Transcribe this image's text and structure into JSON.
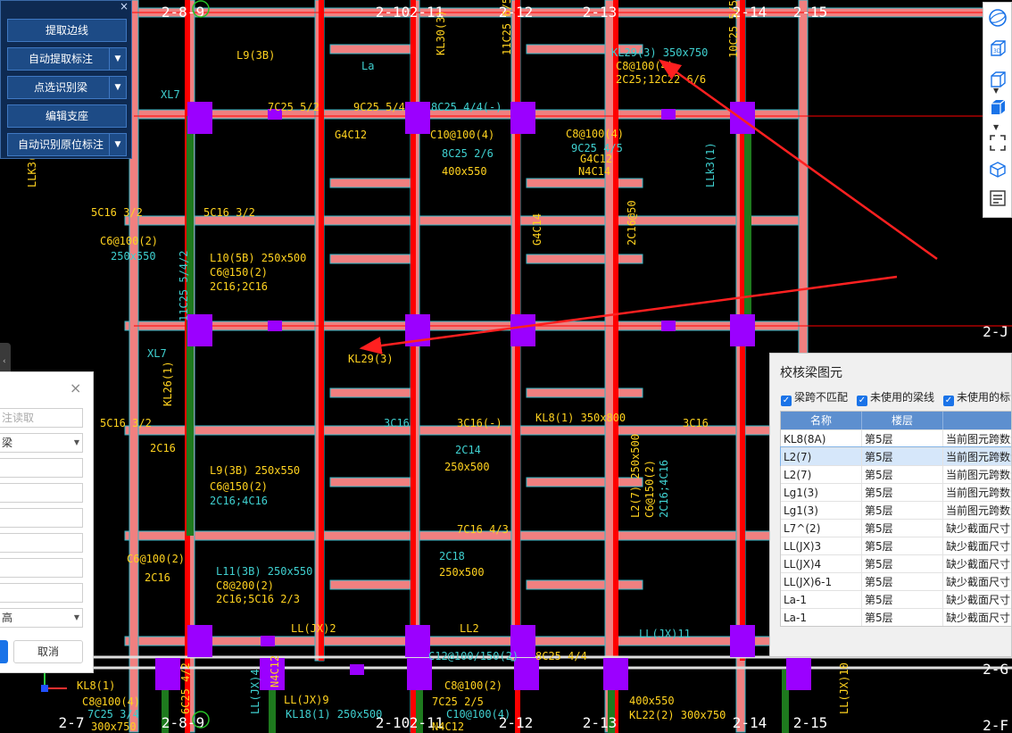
{
  "tool_panel": {
    "close": "×",
    "buttons": [
      {
        "label": "提取边线",
        "dropdown": false
      },
      {
        "label": "自动提取标注",
        "dropdown": true
      },
      {
        "label": "点选识别梁",
        "dropdown": true
      },
      {
        "label": "编辑支座",
        "dropdown": false
      },
      {
        "label": "自动识别原位标注",
        "dropdown": true
      }
    ],
    "dropdown_arrow": "▼"
  },
  "axes": {
    "top": [
      "2-8-9",
      "2-10",
      "2-11",
      "2-12",
      "2-13",
      "2-14",
      "2-15"
    ],
    "bottom": [
      "2-7",
      "2-8-9",
      "2-10",
      "2-11",
      "2-12",
      "2-13",
      "2-14",
      "2-15"
    ],
    "right": [
      "2-J",
      "2-G",
      "2-F"
    ]
  },
  "cad_labels": {
    "yellow": [
      "L9(3B)",
      "La",
      "KL30(3)",
      "11C25 6/5",
      "KL29(3) 350x750",
      "C8@100(4)",
      "2C25;12C22 6/6",
      "10C25 5/5",
      "XL7",
      "7C25 5/2",
      "9C25 5/4",
      "8C25 4/4(-)",
      "5C16 3/2",
      "G4C12",
      "C10@100(4)",
      "8C25 2/6",
      "400x550",
      "C8@100(4)",
      "9C25 4/5",
      "G4C12",
      "N4C14",
      "LLK3(1)",
      "LLk3(1)",
      "5C16 3/2",
      "C6@100(2)",
      "250x550",
      "L10(5B) 250x500",
      "C6@150(2)",
      "2C16;2C16",
      "11C25 5/4/2",
      "G4C14",
      "2C16@50",
      "XL7",
      "KL29(3)",
      "KL26(1)",
      "5C16 3/2",
      "3C16",
      "3C16(-)",
      "2C16",
      "2C14",
      "250x500",
      "L9(3B) 250x550",
      "C6@150(2)",
      "2C16;4C16",
      "L2(7) 250x500",
      "C6@150(2)",
      "2C16;4C16",
      "7C16 4/3",
      "C6@100(2)",
      "2C16",
      "L11(3B) 250x550",
      "C8@200(2)",
      "2C16;5C16 2/3",
      "2C18",
      "250x500",
      "LL(JX)2",
      "LL2",
      "LL(JX)11",
      "KL8(1)",
      "C8@100(4)",
      "7C25 3/4",
      "300x750",
      "N4C12",
      "LL(JX)9",
      "KL18(1) 250x500",
      "C8@100(2)",
      "7C25 2/5",
      "C10@100(4)",
      "N4C12",
      "400x550",
      "KL22(2) 300x750",
      "C12@100/150(2)",
      "8C25 4/4",
      "6C25 4/2",
      "LL(JX)4",
      "LL(JX)10",
      "KL8(1) 350x800",
      "3C16",
      "5C16 3/2"
    ]
  },
  "right_toolbar": {
    "icons": [
      "sphere-icon",
      "cube-3d-icon",
      "cube-outline-icon",
      "cube-solid-icon",
      "fit-view-icon",
      "box-icon",
      "list-view-icon"
    ],
    "label_3d": "3D"
  },
  "left_dialog": {
    "close": "×",
    "fields": [
      {
        "value": "注读取",
        "placeholder": true,
        "dropdown": false
      },
      {
        "value": "梁",
        "placeholder": false,
        "dropdown": true
      },
      {
        "value": "",
        "placeholder": false,
        "dropdown": false
      },
      {
        "value": "",
        "placeholder": false,
        "dropdown": false
      },
      {
        "value": "",
        "placeholder": false,
        "dropdown": false
      },
      {
        "value": "",
        "placeholder": false,
        "dropdown": false
      },
      {
        "value": "",
        "placeholder": false,
        "dropdown": false
      },
      {
        "value": "",
        "placeholder": false,
        "dropdown": false
      },
      {
        "value": "高",
        "placeholder": false,
        "dropdown": true
      }
    ],
    "cancel_label": "取消"
  },
  "check_dialog": {
    "title": "校核梁图元",
    "checkboxes": [
      {
        "label": "梁跨不匹配",
        "checked": true
      },
      {
        "label": "未使用的梁线",
        "checked": true
      },
      {
        "label": "未使用的标注",
        "checked": true
      }
    ],
    "columns": [
      "名称",
      "楼层",
      ""
    ],
    "rows": [
      {
        "name": "KL8(8A)",
        "floor": "第5层",
        "desc": "当前图元跨数大于原位标注跨数"
      },
      {
        "name": "L2(7)",
        "floor": "第5层",
        "desc": "当前图元跨数大于原位标注跨数"
      },
      {
        "name": "L2(7)",
        "floor": "第5层",
        "desc": "当前图元跨数大于原位标注跨数"
      },
      {
        "name": "Lg1(3)",
        "floor": "第5层",
        "desc": "当前图元跨数大于原位标注跨数"
      },
      {
        "name": "Lg1(3)",
        "floor": "第5层",
        "desc": "当前图元跨数大于原位标注跨数"
      },
      {
        "name": "L7^(2)",
        "floor": "第5层",
        "desc": "缺少截面尺寸,无法生成"
      },
      {
        "name": "LL(JX)3",
        "floor": "第5层",
        "desc": "缺少截面尺寸,无法生成"
      },
      {
        "name": "LL(JX)4",
        "floor": "第5层",
        "desc": "缺少截面尺寸,无法生成"
      },
      {
        "name": "LL(JX)6-1",
        "floor": "第5层",
        "desc": "缺少截面尺寸,无法生成"
      },
      {
        "name": "La-1",
        "floor": "第5层",
        "desc": "缺少截面尺寸,无法生成"
      },
      {
        "name": "La-1",
        "floor": "第5层",
        "desc": "缺少截面尺寸,无法生成"
      }
    ],
    "selected_row": 1
  },
  "colors": {
    "background": "#000000",
    "beam_fill": "#f08080",
    "beam_red": "#ff0000",
    "column_purple": "#9b00ff",
    "wall_green": "#1e7a1e",
    "text_yellow": "#ffd21f",
    "text_cyan": "#3fd0d0",
    "axis_green": "#27c427",
    "arrow_red": "#ff2020",
    "panel_blue": "#0e2a52",
    "header_blue": "#5d8fcf"
  }
}
